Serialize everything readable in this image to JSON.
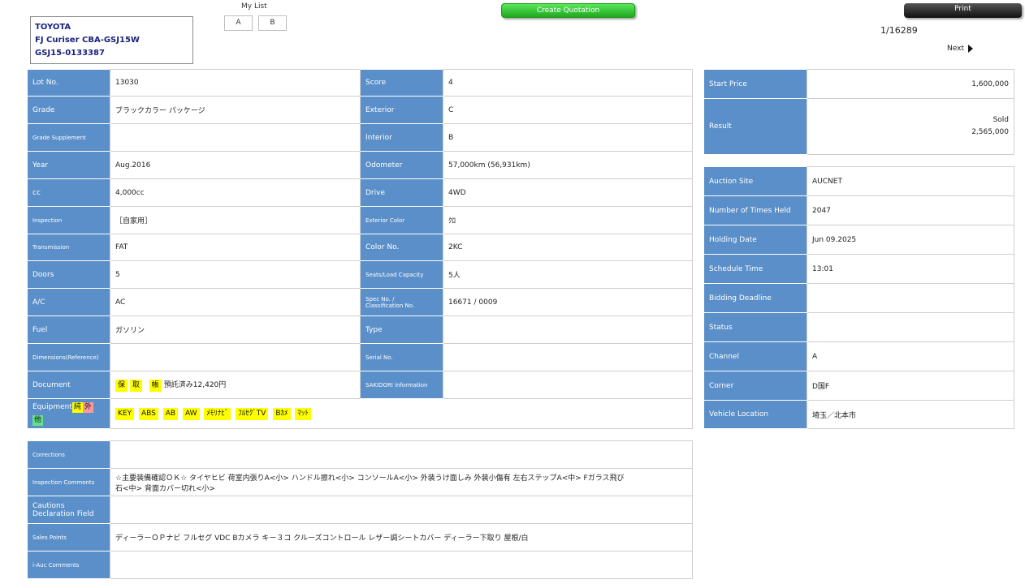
{
  "vehicle": {
    "make": "TOYOTA",
    "model": "FJ Curiser CBA-GSJ15W",
    "chassis": "GSJ15-0133387"
  },
  "my_list": {
    "label": "My List",
    "buttons": [
      "A",
      "B"
    ]
  },
  "actions": {
    "create_quotation": "Create Quotation",
    "print": "Print"
  },
  "pagination": {
    "counter": "1/16289",
    "next": "Next"
  },
  "details": {
    "lot_no": {
      "label": "Lot No.",
      "value": "13030"
    },
    "score": {
      "label": "Score",
      "value": "4"
    },
    "grade": {
      "label": "Grade",
      "value": "ブラックカラー パッケージ"
    },
    "exterior": {
      "label": "Exterior",
      "value": "C"
    },
    "grade_supplement": {
      "label": "Grade Supplement",
      "value": ""
    },
    "interior": {
      "label": "Interior",
      "value": "B"
    },
    "year": {
      "label": "Year",
      "value": "Aug.2016"
    },
    "odometer": {
      "label": "Odometer",
      "value": "57,000km (56,931km)"
    },
    "cc": {
      "label": "cc",
      "value": "4,000cc"
    },
    "drive": {
      "label": "Drive",
      "value": "4WD"
    },
    "inspection": {
      "label": "Inspection",
      "value": "［自家用］"
    },
    "exterior_color": {
      "label": "Exterior Color",
      "value": "ｸﾛ"
    },
    "transmission": {
      "label": "Transmission",
      "value": "FAT"
    },
    "color_no": {
      "label": "Color No.",
      "value": "2KC"
    },
    "doors": {
      "label": "Doors",
      "value": "5"
    },
    "seats": {
      "label": "Seats/Load Capacity",
      "value": "5人"
    },
    "ac": {
      "label": "A/C",
      "value": "AC"
    },
    "spec_no": {
      "label_1": "Spec No. /",
      "label_2": "Classification No.",
      "value": "16671 / 0009"
    },
    "fuel": {
      "label": "Fuel",
      "value": "ガソリン"
    },
    "type": {
      "label": "Type",
      "value": ""
    },
    "dimensions": {
      "label": "Dimensions(Reference)",
      "value": ""
    },
    "serial_no": {
      "label": "Serial No.",
      "value": ""
    },
    "document": {
      "label": "Document",
      "tags": [
        "保",
        "取",
        "帳"
      ],
      "text": "預託済み12,420円"
    },
    "sakidori": {
      "label": "SAKIDORI information",
      "value": ""
    },
    "equipment": {
      "label": "Equipment",
      "legend": [
        "純",
        "外",
        "他"
      ],
      "items": [
        "KEY",
        "ABS",
        "AB",
        "AW",
        "ﾒﾓﾘﾅﾋﾞ",
        "ﾌﾙｾｸﾞTV",
        "Bｶﾒ",
        "ﾏｯﾄ"
      ]
    }
  },
  "comments": {
    "corrections": {
      "label": "Corrections",
      "value": ""
    },
    "inspection_comments": {
      "label": "Inspection Comments",
      "line1": "☆主要装備確認ＯＫ☆ タイヤヒビ 荷室内張りA<小> ハンドル擦れ<小> コンソールA<小> 外装うけ面しみ 外装小傷有 左右ステップA<中> Fガラス飛び",
      "line2": "石<中> 背面カバー切れ<小>"
    },
    "cautions": {
      "label_1": "Cautions",
      "label_2": "Declaration Field",
      "value": ""
    },
    "sales_points": {
      "label": "Sales Points",
      "value": "ディーラーＯＰナビ フルセグ VDC Bカメラ キー３コ クルーズコントロール レザー調シートカバー ディーラー下取り 屋根/白"
    },
    "iauc_comments": {
      "label": "i-Auc Comments",
      "value": ""
    }
  },
  "price": {
    "start_price": {
      "label": "Start Price",
      "value": "1,600,000"
    },
    "result": {
      "label": "Result",
      "status": "Sold",
      "value": "2,565,000"
    }
  },
  "auction": {
    "site": {
      "label": "Auction Site",
      "value": "AUCNET"
    },
    "times_held": {
      "label": "Number of Times Held",
      "value": "2047"
    },
    "holding_date": {
      "label": "Holding Date",
      "value": "Jun 09.2025"
    },
    "schedule_time": {
      "label": "Schedule Time",
      "value": "13:01"
    },
    "bidding_deadline": {
      "label": "Bidding Deadline",
      "value": ""
    },
    "status": {
      "label": "Status",
      "value": ""
    },
    "channel": {
      "label": "Channel",
      "value": "A"
    },
    "corner": {
      "label": "Corner",
      "value": "D国F"
    },
    "vehicle_location": {
      "label": "Vehicle Location",
      "value": "埼玉／北本市"
    }
  }
}
